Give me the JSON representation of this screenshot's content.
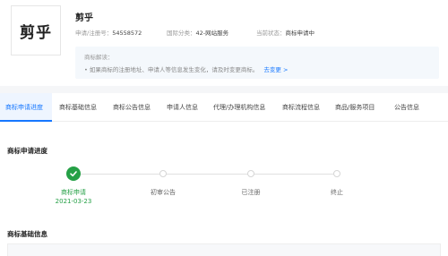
{
  "logo": {
    "text": "剪乎"
  },
  "trademark": {
    "name": "剪乎",
    "reg_no_label": "申请/注册号：",
    "reg_no": "54558572",
    "class_label": "国际分类：",
    "class": "42-网站服务",
    "status_label": "当前状态：",
    "status": "商标申请中"
  },
  "notice": {
    "title": "商标解读：",
    "line": "• 如果商标的注册地址、申请人等信息发生变化，请及时变更商标。",
    "link": "去变更 >"
  },
  "tabs": [
    {
      "label": "商标申请进度",
      "active": true
    },
    {
      "label": "商标基础信息",
      "active": false
    },
    {
      "label": "商标公告信息",
      "active": false
    },
    {
      "label": "申请人信息",
      "active": false
    },
    {
      "label": "代理/办理机构信息",
      "active": false
    },
    {
      "label": "商标流程信息",
      "active": false
    },
    {
      "label": "商品/服务项目",
      "active": false
    },
    {
      "label": "公告信息",
      "active": false
    }
  ],
  "progress": {
    "title": "商标申请进度",
    "steps": [
      {
        "label": "商标申请",
        "date": "2021-03-23",
        "done": true
      },
      {
        "label": "初审公告",
        "date": "",
        "done": false
      },
      {
        "label": "已注册",
        "date": "",
        "done": false
      },
      {
        "label": "终止",
        "date": "",
        "done": false
      }
    ]
  },
  "basic_info": {
    "title": "商标基础信息"
  },
  "colors": {
    "accent": "#1677ff",
    "success": "#25a046"
  },
  "icons": {
    "done": "check-icon",
    "link": "chevron-right-icon"
  }
}
